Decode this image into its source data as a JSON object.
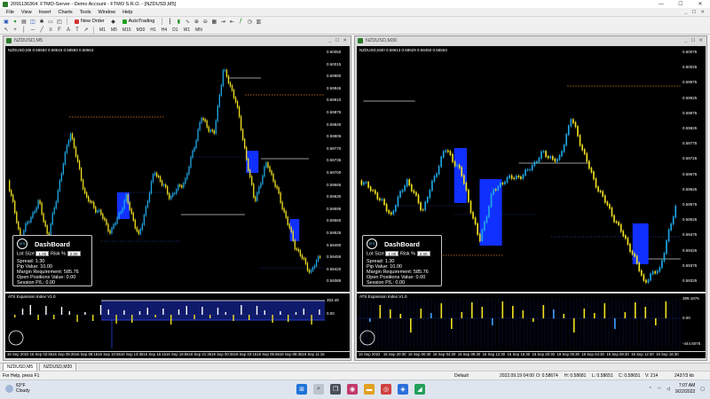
{
  "window": {
    "title": "2091136364: FTMO-Server - Demo Account - FTMO S.R.O. - [NZDUSD,M5]",
    "minimize": "—",
    "maximize": "☐",
    "close": "✕"
  },
  "menu": [
    "File",
    "View",
    "Insert",
    "Charts",
    "Tools",
    "Window",
    "Help"
  ],
  "mdi_controls": [
    "_",
    "☐",
    "✕"
  ],
  "toolbar": {
    "new_order": "New Order",
    "autotrading": "AutoTrading",
    "timeframes": [
      "M1",
      "M5",
      "M15",
      "M30",
      "H1",
      "H4",
      "D1",
      "W1",
      "MN"
    ]
  },
  "charts": [
    {
      "window_title": "NZDUSD,M5",
      "symbol_line": "NZDUSD,M5  0.58593 0.58615 0.58593 0.58663",
      "indicator_name": "ATS Expansion Index V1.0",
      "price_labels": [
        "0.60050",
        "0.60015",
        "0.59980",
        "0.59945",
        "0.59910",
        "0.59875",
        "0.59840",
        "0.59805",
        "0.59770",
        "0.59735",
        "0.59700",
        "0.59665",
        "0.59630",
        "0.59595",
        "0.59560",
        "0.59525",
        "0.59490",
        "0.59455",
        "0.59420",
        "0.59385"
      ],
      "indicator_labels": [
        "353.49",
        "0.00"
      ],
      "time_labels": [
        "16 Sep 2022",
        "16 Sep 02:55",
        "16 Sep 05:35",
        "16 Sep 08:15",
        "16 Sep 10:55",
        "16 Sep 13:35",
        "16 Sep 16:15",
        "16 Sep 18:55",
        "16 Sep 21:35",
        "19 Sep 00:35",
        "19 Sep 03:15",
        "19 Sep 05:55",
        "19 Sep 08:35",
        "19 Sep 11:15"
      ]
    },
    {
      "window_title": "NZDUSD,M30",
      "symbol_line": "NZDUSD,M30  0.58613 0.58629 0.58450 0.58563",
      "indicator_name": "ATS Expansion Index V1.0",
      "price_labels": [
        "0.60075",
        "0.60025",
        "0.59975",
        "0.59925",
        "0.59875",
        "0.59825",
        "0.59775",
        "0.59725",
        "0.59675",
        "0.59625",
        "0.59575",
        "0.59525",
        "0.59475",
        "0.59425",
        "0.59375",
        "0.59325"
      ],
      "indicator_labels": [
        "389.1875",
        "0.00",
        "-444.5075"
      ],
      "time_labels": [
        "15 Sep 2022",
        "15 Sep 20:30",
        "16 Sep 00:30",
        "16 Sep 04:30",
        "16 Sep 08:30",
        "16 Sep 12:30",
        "16 Sep 16:30",
        "16 Sep 20:30",
        "19 Sep 00:30",
        "19 Sep 04:30",
        "19 Sep 08:30",
        "19 Sep 12:30",
        "19 Sep 16:30"
      ]
    }
  ],
  "dashboard": {
    "logo": "ATS",
    "title": "DashBoard",
    "lot_size_label": "Lot Size",
    "lot_size_value": "1.00",
    "risk_label": "Risk %",
    "risk_value": "2.00",
    "spread": "Spread: 1.30",
    "pip_value": "Pip Value: 10.00",
    "margin": "Margin Requirement: 585.76",
    "open_positions": "Open Positions Value: 0.00",
    "session_pl": "Session P/L: 0.00"
  },
  "tabs": [
    "NZDUSD,M5",
    "NZDUSD,M30"
  ],
  "status": {
    "help": "For Help, press F1",
    "profile": "Default",
    "datetime": "2022.09.19 04:00",
    "open": "O: 0.58674",
    "high": "H: 0.58681",
    "low": "L: 0.58651",
    "close": "C: 0.58651",
    "volume": "V: 214",
    "traffic": "2437/3 kb"
  },
  "taskbar": {
    "temperature": "63°F",
    "weather": "Cloudy",
    "time": "7:07 AM",
    "date": "9/22/2022"
  },
  "colors": {
    "chart_bg": "#000000",
    "bull": "#1fa7e6",
    "bear": "#f0e020",
    "box": "#1030ff",
    "level": "#e08020",
    "grid_dot": "#2040a0"
  }
}
